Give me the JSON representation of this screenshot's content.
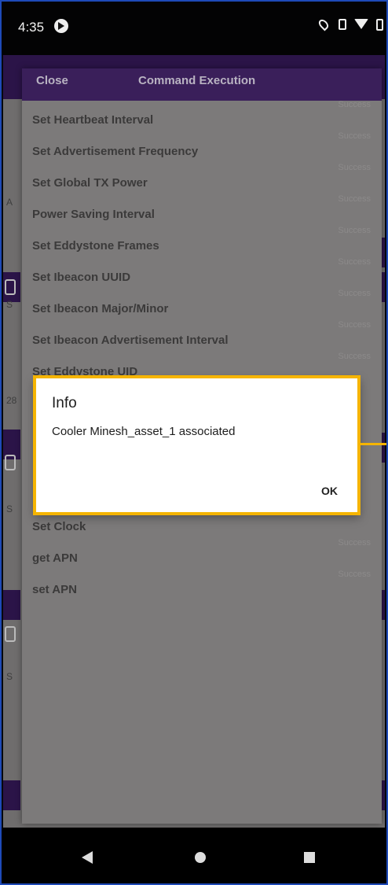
{
  "status_bar": {
    "time": "4:35"
  },
  "sheet": {
    "close_label": "Close",
    "title": "Command Execution",
    "commands": [
      {
        "label": "Set Heartbeat Interval",
        "result": "Success"
      },
      {
        "label": "Set Advertisement Frequency",
        "result": "Success"
      },
      {
        "label": "Set Global TX Power",
        "result": "Success"
      },
      {
        "label": "Power Saving Interval",
        "result": "Success"
      },
      {
        "label": "Set Eddystone Frames",
        "result": "Success"
      },
      {
        "label": "Set Ibeacon UUID",
        "result": "Success"
      },
      {
        "label": "Set Ibeacon Major/Minor",
        "result": "Success"
      },
      {
        "label": "Set Ibeacon Advertisement Interval",
        "result": "Success"
      },
      {
        "label": "Set Eddystone UID",
        "result": "Success"
      },
      {
        "label": "Set Clock",
        "result": "Success"
      },
      {
        "label": "get APN",
        "result": "Success"
      },
      {
        "label": "set APN",
        "result": ""
      }
    ]
  },
  "dialog": {
    "title": "Info",
    "message": "Cooler Minesh_asset_1 associated",
    "ok_label": "OK"
  },
  "background_fragments": {
    "a": "A",
    "s": "S",
    "n28": "28"
  },
  "colors": {
    "highlight": "#f5b400",
    "header_purple": "#3a1f5a",
    "scrim_gray": "#7c7a7a"
  }
}
